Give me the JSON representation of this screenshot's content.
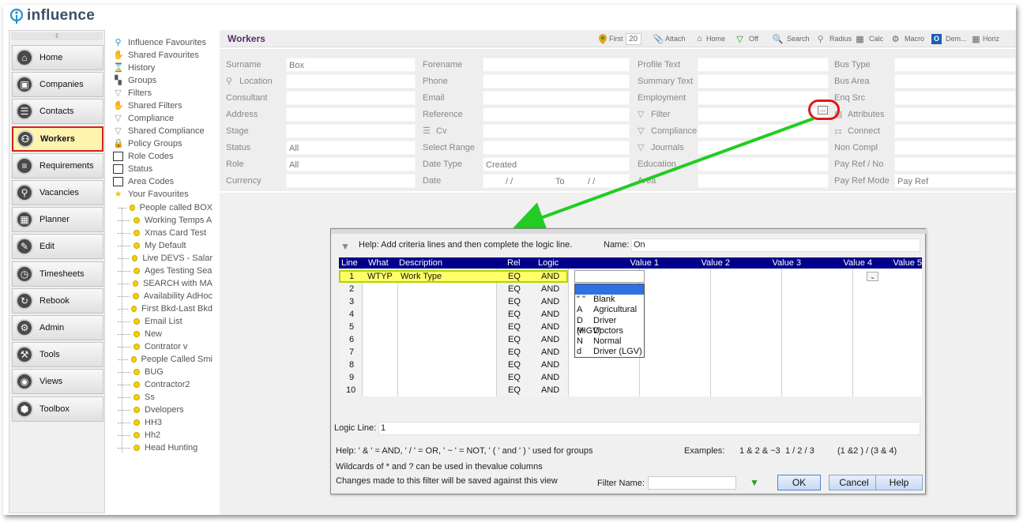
{
  "app": {
    "name": "influence"
  },
  "nav": {
    "items": [
      {
        "label": "Home",
        "icon": "home-icon"
      },
      {
        "label": "Companies",
        "icon": "companies-icon"
      },
      {
        "label": "Contacts",
        "icon": "contacts-icon"
      },
      {
        "label": "Workers",
        "icon": "workers-icon",
        "active": true
      },
      {
        "label": "Requirements",
        "icon": "requirements-icon"
      },
      {
        "label": "Vacancies",
        "icon": "vacancies-icon"
      },
      {
        "label": "Planner",
        "icon": "planner-icon"
      },
      {
        "label": "Edit",
        "icon": "edit-icon"
      },
      {
        "label": "Timesheets",
        "icon": "timesheets-icon"
      },
      {
        "label": "Rebook",
        "icon": "rebook-icon"
      },
      {
        "label": "Admin",
        "icon": "admin-icon"
      },
      {
        "label": "Tools",
        "icon": "tools-icon"
      },
      {
        "label": "Views",
        "icon": "views-icon"
      },
      {
        "label": "Toolbox",
        "icon": "toolbox-icon"
      }
    ]
  },
  "tree": {
    "items": [
      "Influence Favourites",
      "Shared Favourites",
      "History",
      "Groups",
      "Filters",
      "Shared Filters",
      "Compliance",
      "Shared Compliance",
      "Policy Groups",
      "Role Codes",
      "Status",
      "Area Codes",
      "Your Favourites"
    ],
    "favourites": [
      "People called BOX",
      "Working Temps A",
      "Xmas Card Test",
      "My Default",
      "Live DEVS - Salar",
      "Ages Testing Sea",
      "SEARCH with MA",
      "Availability AdHoc",
      "First Bkd-Last Bkd",
      "Email List",
      "New",
      "Contrator v",
      "People Called Smi",
      "BUG",
      "Contractor2",
      "Ss",
      "Dvelopers",
      "HH3",
      "Hh2",
      "Head Hunting"
    ]
  },
  "header": {
    "title": "Workers",
    "first_label": "First",
    "count": "20",
    "attach": "Attach",
    "home": "Home",
    "off": "Off",
    "search": "Search",
    "radius": "Radius",
    "calc": "Calc",
    "macro": "Macro",
    "dem": "Dem...",
    "horiz": "Horiz"
  },
  "form": {
    "col1": [
      {
        "label": "Surname",
        "value": "Box"
      },
      {
        "label": "Location",
        "value": ""
      },
      {
        "label": "Consultant",
        "value": ""
      },
      {
        "label": "Address",
        "value": ""
      },
      {
        "label": "Stage",
        "value": ""
      },
      {
        "label": "Status",
        "value": "All"
      },
      {
        "label": "Role",
        "value": "All"
      },
      {
        "label": "Currency",
        "value": ""
      }
    ],
    "col2": [
      {
        "label": "Forename",
        "value": ""
      },
      {
        "label": "Phone",
        "value": ""
      },
      {
        "label": "Email",
        "value": ""
      },
      {
        "label": "Reference",
        "value": ""
      },
      {
        "label": "Cv",
        "value": ""
      },
      {
        "label": "Select Range",
        "value": ""
      },
      {
        "label": "Date Type",
        "value": "Created"
      },
      {
        "label": "Date",
        "value": "/ /"
      }
    ],
    "date_to_label": "To",
    "date_to_value": "/ /",
    "col3": [
      {
        "label": "Profile Text",
        "value": ""
      },
      {
        "label": "Summary Text",
        "value": ""
      },
      {
        "label": "Employment",
        "value": ""
      },
      {
        "label": "Filter",
        "value": ""
      },
      {
        "label": "Compliance",
        "value": ""
      },
      {
        "label": "Journals",
        "value": ""
      },
      {
        "label": "Education",
        "value": ""
      },
      {
        "label": "Area",
        "value": ""
      }
    ],
    "col4": [
      {
        "label": "Bus Type",
        "value": ""
      },
      {
        "label": "Bus Area",
        "value": ""
      },
      {
        "label": "Enq Src",
        "value": ""
      },
      {
        "label": "Attributes",
        "value": ""
      },
      {
        "label": "Connect",
        "value": ""
      },
      {
        "label": "Non Compl",
        "value": ""
      },
      {
        "label": "Pay Ref / No",
        "value": ""
      },
      {
        "label": "Pay Ref Mode",
        "value": "Pay Ref"
      }
    ],
    "ellipsis": "..."
  },
  "dialog": {
    "help": "Help: Add criteria lines and then complete the logic line.",
    "name_label": "Name:",
    "name_value": "On",
    "columns": [
      "Line",
      "What",
      "Description",
      "Rel",
      "Logic",
      "Value 1",
      "Value 2",
      "Value 3",
      "Value 4",
      "Value 5"
    ],
    "rows": [
      {
        "line": "1",
        "what": "WTYP",
        "desc": "Work Type",
        "rel": "EQ",
        "logic": "AND"
      },
      {
        "line": "2",
        "what": "",
        "desc": "",
        "rel": "EQ",
        "logic": "AND"
      },
      {
        "line": "3",
        "what": "",
        "desc": "",
        "rel": "EQ",
        "logic": "AND"
      },
      {
        "line": "4",
        "what": "",
        "desc": "",
        "rel": "EQ",
        "logic": "AND"
      },
      {
        "line": "5",
        "what": "",
        "desc": "",
        "rel": "EQ",
        "logic": "AND"
      },
      {
        "line": "6",
        "what": "",
        "desc": "",
        "rel": "EQ",
        "logic": "AND"
      },
      {
        "line": "7",
        "what": "",
        "desc": "",
        "rel": "EQ",
        "logic": "AND"
      },
      {
        "line": "8",
        "what": "",
        "desc": "",
        "rel": "EQ",
        "logic": "AND"
      },
      {
        "line": "9",
        "what": "",
        "desc": "",
        "rel": "EQ",
        "logic": "AND"
      },
      {
        "line": "10",
        "what": "",
        "desc": "",
        "rel": "EQ",
        "logic": "AND"
      }
    ],
    "dropdown_options": [
      {
        "key": "",
        "label": ""
      },
      {
        "key": "\" \"",
        "label": "Blank"
      },
      {
        "key": "A",
        "label": "Agricultural"
      },
      {
        "key": "D",
        "label": "Driver (HGV)"
      },
      {
        "key": "M",
        "label": "Doctors"
      },
      {
        "key": "N",
        "label": "Normal"
      },
      {
        "key": "d",
        "label": "Driver (LGV)"
      }
    ],
    "logic_label": "Logic Line:",
    "logic_value": "1",
    "help_line1": "Help: ' & ' = AND,  ' / ' = OR,  ' ~ ' = NOT,  ' ( ' and ' ) ' used for groups",
    "help_line2": "Wildcards of * and ? can be used in thevalue columns",
    "help_line3": "Changes made to this filter will be saved against this view",
    "examples_label": "Examples:",
    "example1": "1 & 2 & ~3",
    "example2": "1 / 2 / 3",
    "example3": "(1 &2 ) / (3 & 4)",
    "filter_name_label": "Filter Name:",
    "filter_name_value": "",
    "ok": "OK",
    "cancel": "Cancel",
    "help_button": "Help"
  },
  "colors": {
    "nav_active_border": "#d62020",
    "highlight": "#ffff66",
    "grid_header": "#00008b",
    "arrow": "#22cc22",
    "title": "#5a2d6b"
  }
}
